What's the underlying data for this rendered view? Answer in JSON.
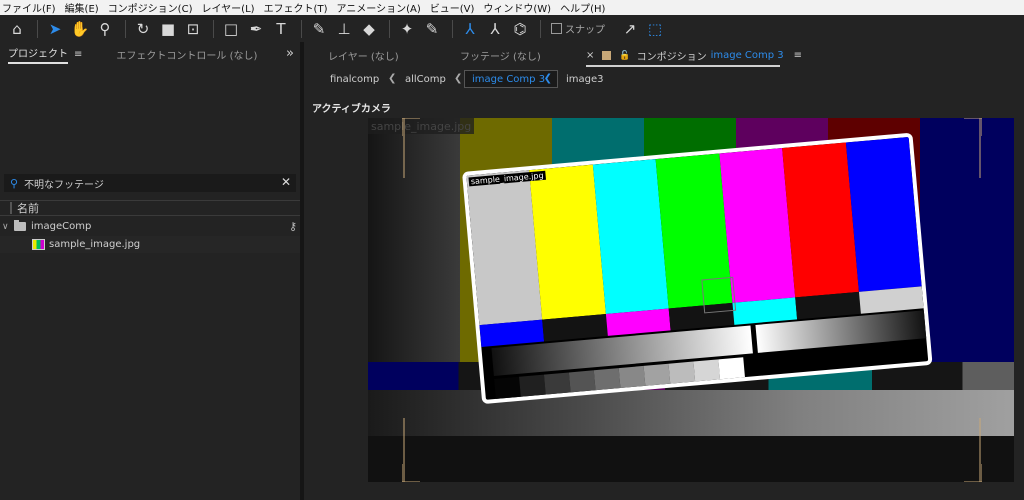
{
  "menu": [
    "ファイル(F)",
    "編集(E)",
    "コンポジション(C)",
    "レイヤー(L)",
    "エフェクト(T)",
    "アニメーション(A)",
    "ビュー(V)",
    "ウィンドウ(W)",
    "ヘルプ(H)"
  ],
  "toolbar": {
    "snap_label": "スナップ"
  },
  "project_panel": {
    "tab_active": "プロジェクト",
    "tab_inactive": "エフェクトコントロール (なし)",
    "more": "»",
    "search_value": "不明なフッテージ",
    "column_name": "名前",
    "items": [
      {
        "name": "imageComp",
        "type": "folder"
      },
      {
        "name": "sample_image.jpg",
        "type": "footage"
      }
    ]
  },
  "comp_panel": {
    "tab_layer": "レイヤー (なし)",
    "tab_footage": "フッテージ (なし)",
    "tab_comp_prefix": "コンポジション",
    "tab_comp_name": "image Comp 3",
    "breadcrumbs": [
      "finalcomp",
      "allComp",
      "image Comp 3",
      "image3"
    ],
    "viewer_title": "アクティブカメラ",
    "layer_label": "sample_image.jpg",
    "bg_label": "sample_image.jpg"
  },
  "colors": {
    "accent": "#2d8ceb",
    "bars_top": [
      "#c0c0c0",
      "#c0c000",
      "#00c0c0",
      "#00c000",
      "#c000c0",
      "#c00000",
      "#0000c0"
    ],
    "bars_mid": [
      "#0000c0",
      "#131313",
      "#c000c0",
      "#131313",
      "#00c0c0",
      "#131313",
      "#c0c0c0"
    ]
  }
}
